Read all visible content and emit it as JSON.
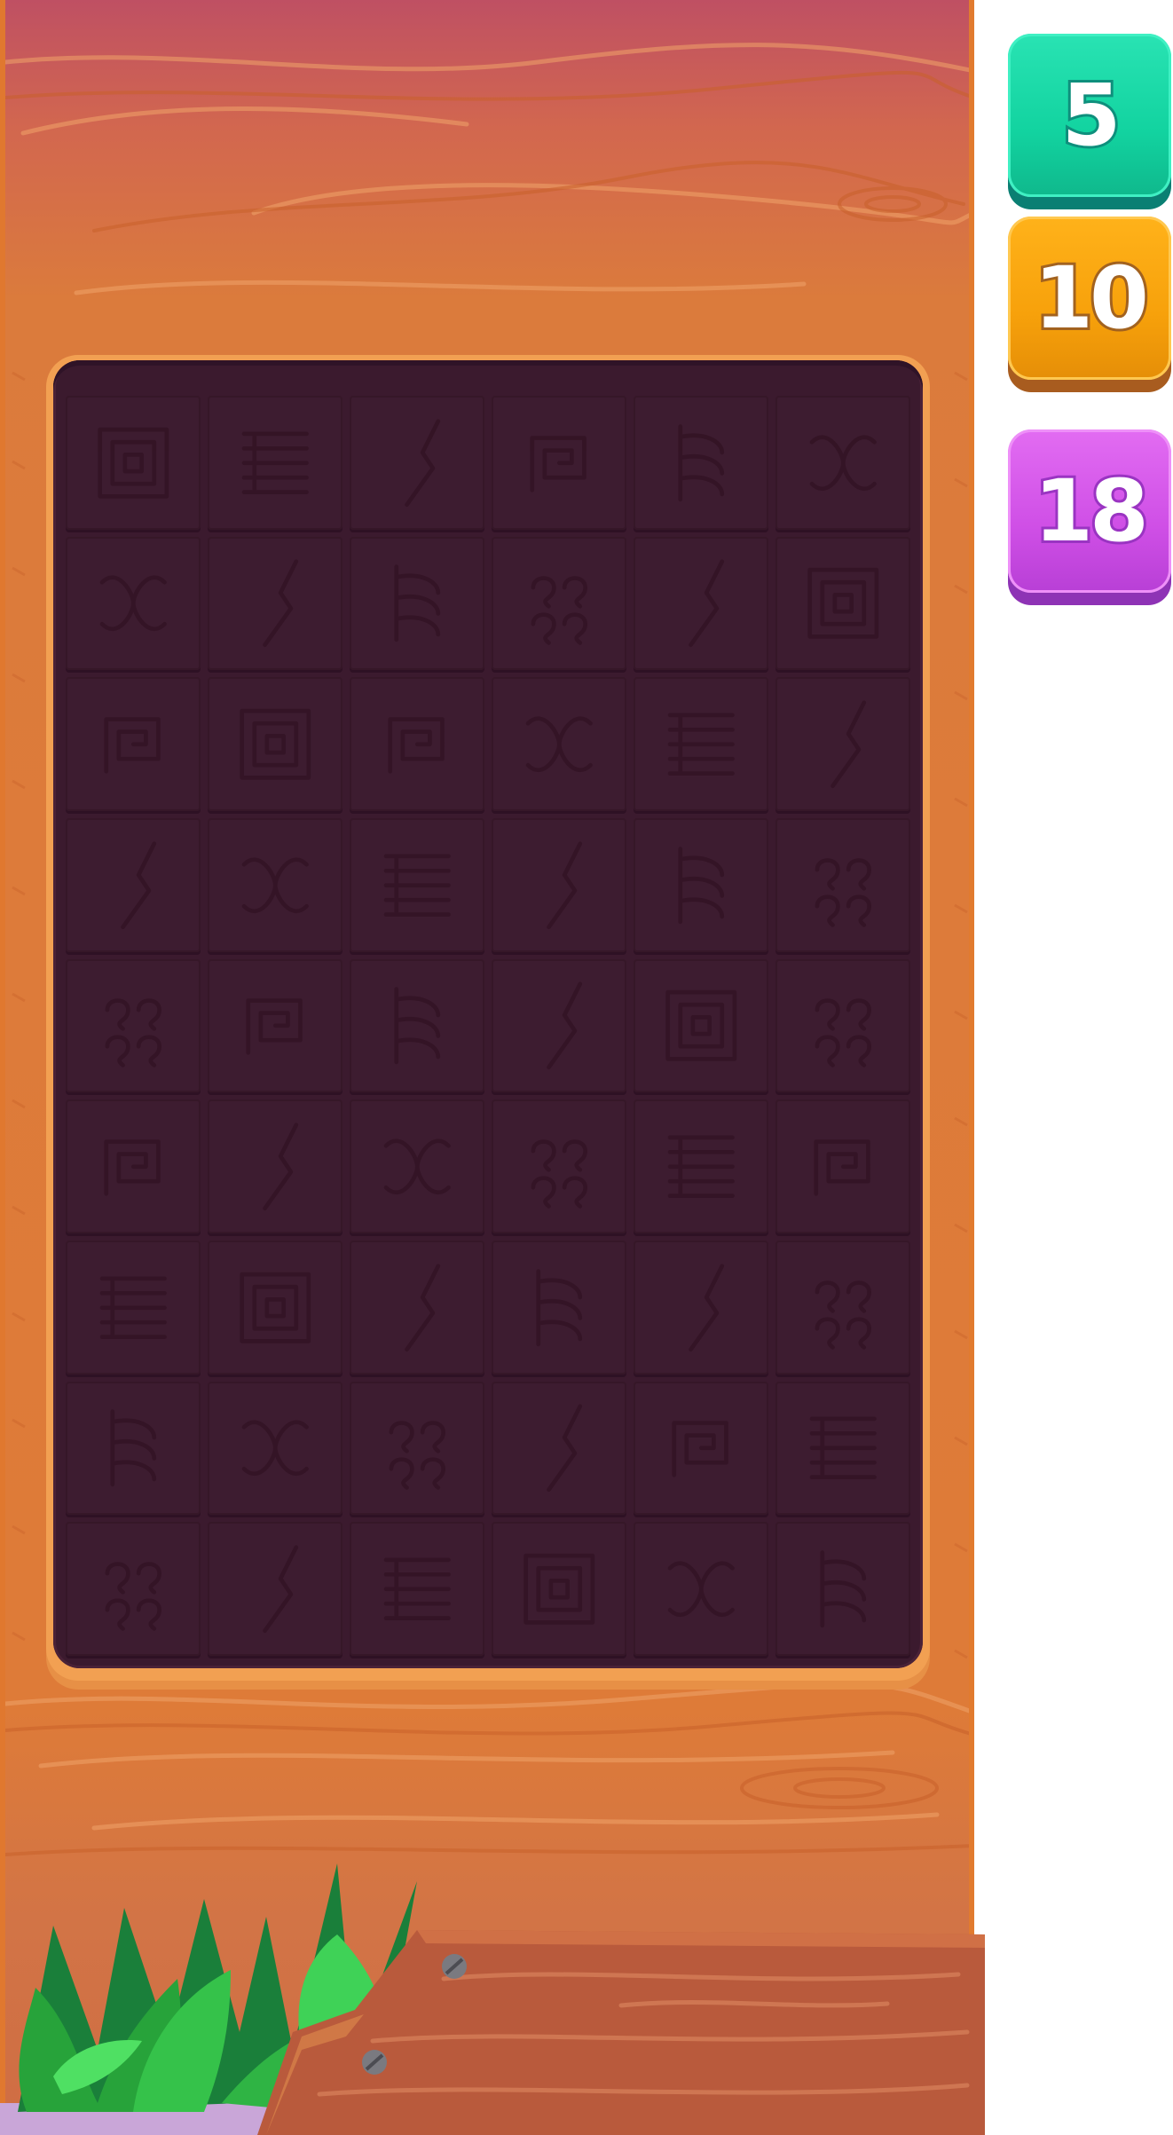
{
  "score_buttons": [
    {
      "value": "5",
      "color": "#12d3a0"
    },
    {
      "value": "10",
      "color": "#f7a10b"
    },
    {
      "value": "18",
      "color": "#cf4fe6"
    }
  ],
  "board": {
    "rows": 9,
    "columns": 6,
    "cells": [
      [
        "spiral-square",
        "lines",
        "crack",
        "spiral",
        "comb",
        "knot"
      ],
      [
        "knot",
        "crack",
        "comb",
        "swirl",
        "crack",
        "spiral-square"
      ],
      [
        "spiral",
        "spiral-square",
        "spiral",
        "knot",
        "lines",
        "crack"
      ],
      [
        "crack",
        "knot",
        "lines",
        "crack",
        "comb",
        "swirl"
      ],
      [
        "swirl",
        "spiral",
        "comb",
        "crack",
        "spiral-square",
        "swirl"
      ],
      [
        "spiral",
        "crack",
        "knot",
        "swirl",
        "lines",
        "spiral"
      ],
      [
        "lines",
        "spiral-square",
        "crack",
        "comb",
        "crack",
        "swirl"
      ],
      [
        "comb",
        "knot",
        "swirl",
        "crack",
        "spiral",
        "lines"
      ],
      [
        "swirl",
        "crack",
        "lines",
        "spiral-square",
        "knot",
        "comb"
      ]
    ]
  },
  "colors": {
    "wood": "#dd7b3a",
    "board": "#3b1a2e",
    "grass": "#27a33a"
  }
}
